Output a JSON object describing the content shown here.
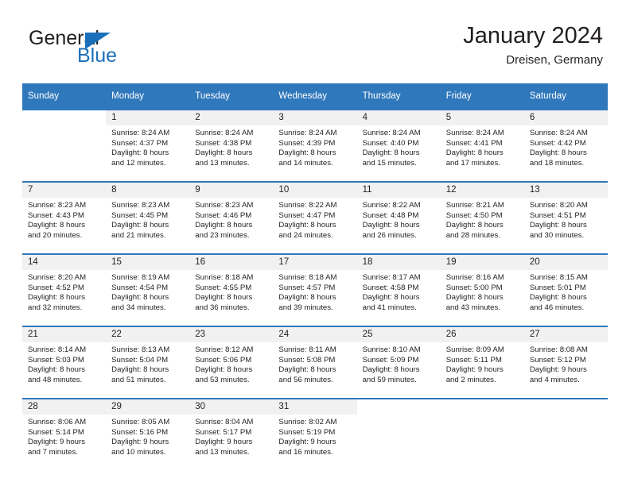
{
  "logo": {
    "word_top": "General",
    "word_bottom": "Blue",
    "triangle_color": "#1a6fba"
  },
  "header": {
    "title": "January 2024",
    "subtitle": "Dreisen, Germany"
  },
  "colors": {
    "header_blue": "#3078bc",
    "daynum_band": "#f1f1f1",
    "text": "#231f20"
  },
  "calendar": {
    "weekday_headers": [
      "Sunday",
      "Monday",
      "Tuesday",
      "Wednesday",
      "Thursday",
      "Friday",
      "Saturday"
    ],
    "weeks": [
      [
        {
          "day": "",
          "sunrise": "",
          "sunset": "",
          "daylight_1": "",
          "daylight_2": "",
          "blank": true
        },
        {
          "day": "1",
          "sunrise": "Sunrise: 8:24 AM",
          "sunset": "Sunset: 4:37 PM",
          "daylight_1": "Daylight: 8 hours",
          "daylight_2": "and 12 minutes."
        },
        {
          "day": "2",
          "sunrise": "Sunrise: 8:24 AM",
          "sunset": "Sunset: 4:38 PM",
          "daylight_1": "Daylight: 8 hours",
          "daylight_2": "and 13 minutes."
        },
        {
          "day": "3",
          "sunrise": "Sunrise: 8:24 AM",
          "sunset": "Sunset: 4:39 PM",
          "daylight_1": "Daylight: 8 hours",
          "daylight_2": "and 14 minutes."
        },
        {
          "day": "4",
          "sunrise": "Sunrise: 8:24 AM",
          "sunset": "Sunset: 4:40 PM",
          "daylight_1": "Daylight: 8 hours",
          "daylight_2": "and 15 minutes."
        },
        {
          "day": "5",
          "sunrise": "Sunrise: 8:24 AM",
          "sunset": "Sunset: 4:41 PM",
          "daylight_1": "Daylight: 8 hours",
          "daylight_2": "and 17 minutes."
        },
        {
          "day": "6",
          "sunrise": "Sunrise: 8:24 AM",
          "sunset": "Sunset: 4:42 PM",
          "daylight_1": "Daylight: 8 hours",
          "daylight_2": "and 18 minutes."
        }
      ],
      [
        {
          "day": "7",
          "sunrise": "Sunrise: 8:23 AM",
          "sunset": "Sunset: 4:43 PM",
          "daylight_1": "Daylight: 8 hours",
          "daylight_2": "and 20 minutes."
        },
        {
          "day": "8",
          "sunrise": "Sunrise: 8:23 AM",
          "sunset": "Sunset: 4:45 PM",
          "daylight_1": "Daylight: 8 hours",
          "daylight_2": "and 21 minutes."
        },
        {
          "day": "9",
          "sunrise": "Sunrise: 8:23 AM",
          "sunset": "Sunset: 4:46 PM",
          "daylight_1": "Daylight: 8 hours",
          "daylight_2": "and 23 minutes."
        },
        {
          "day": "10",
          "sunrise": "Sunrise: 8:22 AM",
          "sunset": "Sunset: 4:47 PM",
          "daylight_1": "Daylight: 8 hours",
          "daylight_2": "and 24 minutes."
        },
        {
          "day": "11",
          "sunrise": "Sunrise: 8:22 AM",
          "sunset": "Sunset: 4:48 PM",
          "daylight_1": "Daylight: 8 hours",
          "daylight_2": "and 26 minutes."
        },
        {
          "day": "12",
          "sunrise": "Sunrise: 8:21 AM",
          "sunset": "Sunset: 4:50 PM",
          "daylight_1": "Daylight: 8 hours",
          "daylight_2": "and 28 minutes."
        },
        {
          "day": "13",
          "sunrise": "Sunrise: 8:20 AM",
          "sunset": "Sunset: 4:51 PM",
          "daylight_1": "Daylight: 8 hours",
          "daylight_2": "and 30 minutes."
        }
      ],
      [
        {
          "day": "14",
          "sunrise": "Sunrise: 8:20 AM",
          "sunset": "Sunset: 4:52 PM",
          "daylight_1": "Daylight: 8 hours",
          "daylight_2": "and 32 minutes."
        },
        {
          "day": "15",
          "sunrise": "Sunrise: 8:19 AM",
          "sunset": "Sunset: 4:54 PM",
          "daylight_1": "Daylight: 8 hours",
          "daylight_2": "and 34 minutes."
        },
        {
          "day": "16",
          "sunrise": "Sunrise: 8:18 AM",
          "sunset": "Sunset: 4:55 PM",
          "daylight_1": "Daylight: 8 hours",
          "daylight_2": "and 36 minutes."
        },
        {
          "day": "17",
          "sunrise": "Sunrise: 8:18 AM",
          "sunset": "Sunset: 4:57 PM",
          "daylight_1": "Daylight: 8 hours",
          "daylight_2": "and 39 minutes."
        },
        {
          "day": "18",
          "sunrise": "Sunrise: 8:17 AM",
          "sunset": "Sunset: 4:58 PM",
          "daylight_1": "Daylight: 8 hours",
          "daylight_2": "and 41 minutes."
        },
        {
          "day": "19",
          "sunrise": "Sunrise: 8:16 AM",
          "sunset": "Sunset: 5:00 PM",
          "daylight_1": "Daylight: 8 hours",
          "daylight_2": "and 43 minutes."
        },
        {
          "day": "20",
          "sunrise": "Sunrise: 8:15 AM",
          "sunset": "Sunset: 5:01 PM",
          "daylight_1": "Daylight: 8 hours",
          "daylight_2": "and 46 minutes."
        }
      ],
      [
        {
          "day": "21",
          "sunrise": "Sunrise: 8:14 AM",
          "sunset": "Sunset: 5:03 PM",
          "daylight_1": "Daylight: 8 hours",
          "daylight_2": "and 48 minutes."
        },
        {
          "day": "22",
          "sunrise": "Sunrise: 8:13 AM",
          "sunset": "Sunset: 5:04 PM",
          "daylight_1": "Daylight: 8 hours",
          "daylight_2": "and 51 minutes."
        },
        {
          "day": "23",
          "sunrise": "Sunrise: 8:12 AM",
          "sunset": "Sunset: 5:06 PM",
          "daylight_1": "Daylight: 8 hours",
          "daylight_2": "and 53 minutes."
        },
        {
          "day": "24",
          "sunrise": "Sunrise: 8:11 AM",
          "sunset": "Sunset: 5:08 PM",
          "daylight_1": "Daylight: 8 hours",
          "daylight_2": "and 56 minutes."
        },
        {
          "day": "25",
          "sunrise": "Sunrise: 8:10 AM",
          "sunset": "Sunset: 5:09 PM",
          "daylight_1": "Daylight: 8 hours",
          "daylight_2": "and 59 minutes."
        },
        {
          "day": "26",
          "sunrise": "Sunrise: 8:09 AM",
          "sunset": "Sunset: 5:11 PM",
          "daylight_1": "Daylight: 9 hours",
          "daylight_2": "and 2 minutes."
        },
        {
          "day": "27",
          "sunrise": "Sunrise: 8:08 AM",
          "sunset": "Sunset: 5:12 PM",
          "daylight_1": "Daylight: 9 hours",
          "daylight_2": "and 4 minutes."
        }
      ],
      [
        {
          "day": "28",
          "sunrise": "Sunrise: 8:06 AM",
          "sunset": "Sunset: 5:14 PM",
          "daylight_1": "Daylight: 9 hours",
          "daylight_2": "and 7 minutes."
        },
        {
          "day": "29",
          "sunrise": "Sunrise: 8:05 AM",
          "sunset": "Sunset: 5:16 PM",
          "daylight_1": "Daylight: 9 hours",
          "daylight_2": "and 10 minutes."
        },
        {
          "day": "30",
          "sunrise": "Sunrise: 8:04 AM",
          "sunset": "Sunset: 5:17 PM",
          "daylight_1": "Daylight: 9 hours",
          "daylight_2": "and 13 minutes."
        },
        {
          "day": "31",
          "sunrise": "Sunrise: 8:02 AM",
          "sunset": "Sunset: 5:19 PM",
          "daylight_1": "Daylight: 9 hours",
          "daylight_2": "and 16 minutes."
        },
        {
          "day": "",
          "sunrise": "",
          "sunset": "",
          "daylight_1": "",
          "daylight_2": "",
          "blank": true
        },
        {
          "day": "",
          "sunrise": "",
          "sunset": "",
          "daylight_1": "",
          "daylight_2": "",
          "blank": true
        },
        {
          "day": "",
          "sunrise": "",
          "sunset": "",
          "daylight_1": "",
          "daylight_2": "",
          "blank": true
        }
      ]
    ]
  }
}
